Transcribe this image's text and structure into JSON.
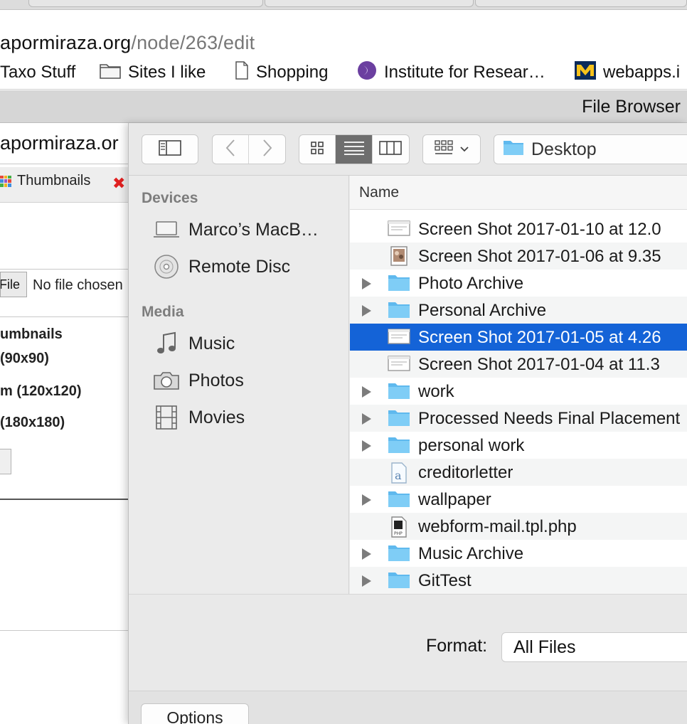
{
  "browser": {
    "url_host": "apormiraza.org",
    "url_path": "/node/263/edit",
    "bookmarks": [
      {
        "label": "Taxo Stuff",
        "icon": "none"
      },
      {
        "label": "Sites I like",
        "icon": "folder-icon"
      },
      {
        "label": "Shopping",
        "icon": "page-icon"
      },
      {
        "label": "Institute for Resear…",
        "icon": "institute-logo-icon"
      },
      {
        "label": "webapps.i",
        "icon": "michigan-m-icon"
      }
    ],
    "window_title": "File Browser"
  },
  "page": {
    "url_fragment": "apormiraza.or",
    "tab_label": "Thumbnails",
    "file_button": "File",
    "no_file": "No file chosen",
    "sizes": [
      "umbnails",
      "(90x90)",
      "m (120x120)",
      "(180x180)"
    ]
  },
  "dialog": {
    "location": "Desktop",
    "sidebar": {
      "devices_heading": "Devices",
      "devices": [
        "Marco’s MacB…",
        "Remote Disc"
      ],
      "media_heading": "Media",
      "media": [
        "Music",
        "Photos",
        "Movies"
      ]
    },
    "column_name": "Name",
    "files": [
      {
        "name": "Screen Shot 2017-01-10 at 12.0",
        "type": "screenshot",
        "expandable": false,
        "selected": false
      },
      {
        "name": "Screen Shot 2017-01-06 at 9.35",
        "type": "photo",
        "expandable": false,
        "selected": false
      },
      {
        "name": "Photo Archive",
        "type": "folder",
        "expandable": true,
        "selected": false
      },
      {
        "name": "Personal Archive",
        "type": "folder",
        "expandable": true,
        "selected": false
      },
      {
        "name": "Screen Shot 2017-01-05 at 4.26",
        "type": "screenshot",
        "expandable": false,
        "selected": true
      },
      {
        "name": "Screen Shot 2017-01-04 at 11.3",
        "type": "screenshot",
        "expandable": false,
        "selected": false
      },
      {
        "name": "work",
        "type": "folder",
        "expandable": true,
        "selected": false
      },
      {
        "name": "Processed Needs Final Placement",
        "type": "folder",
        "expandable": true,
        "selected": false
      },
      {
        "name": "personal work",
        "type": "folder",
        "expandable": true,
        "selected": false
      },
      {
        "name": "creditorletter",
        "type": "textdoc",
        "expandable": false,
        "selected": false
      },
      {
        "name": "wallpaper",
        "type": "folder",
        "expandable": true,
        "selected": false
      },
      {
        "name": "webform-mail.tpl.php",
        "type": "php",
        "expandable": false,
        "selected": false
      },
      {
        "name": "Music Archive",
        "type": "folder",
        "expandable": true,
        "selected": false
      },
      {
        "name": "GitTest",
        "type": "folder",
        "expandable": true,
        "selected": false
      }
    ],
    "format_label": "Format:",
    "format_value": "All Files",
    "options_label": "Options"
  },
  "colors": {
    "selection": "#1463d7",
    "folder": "#69c4f3",
    "disabled_text": "#7d7d7d"
  }
}
